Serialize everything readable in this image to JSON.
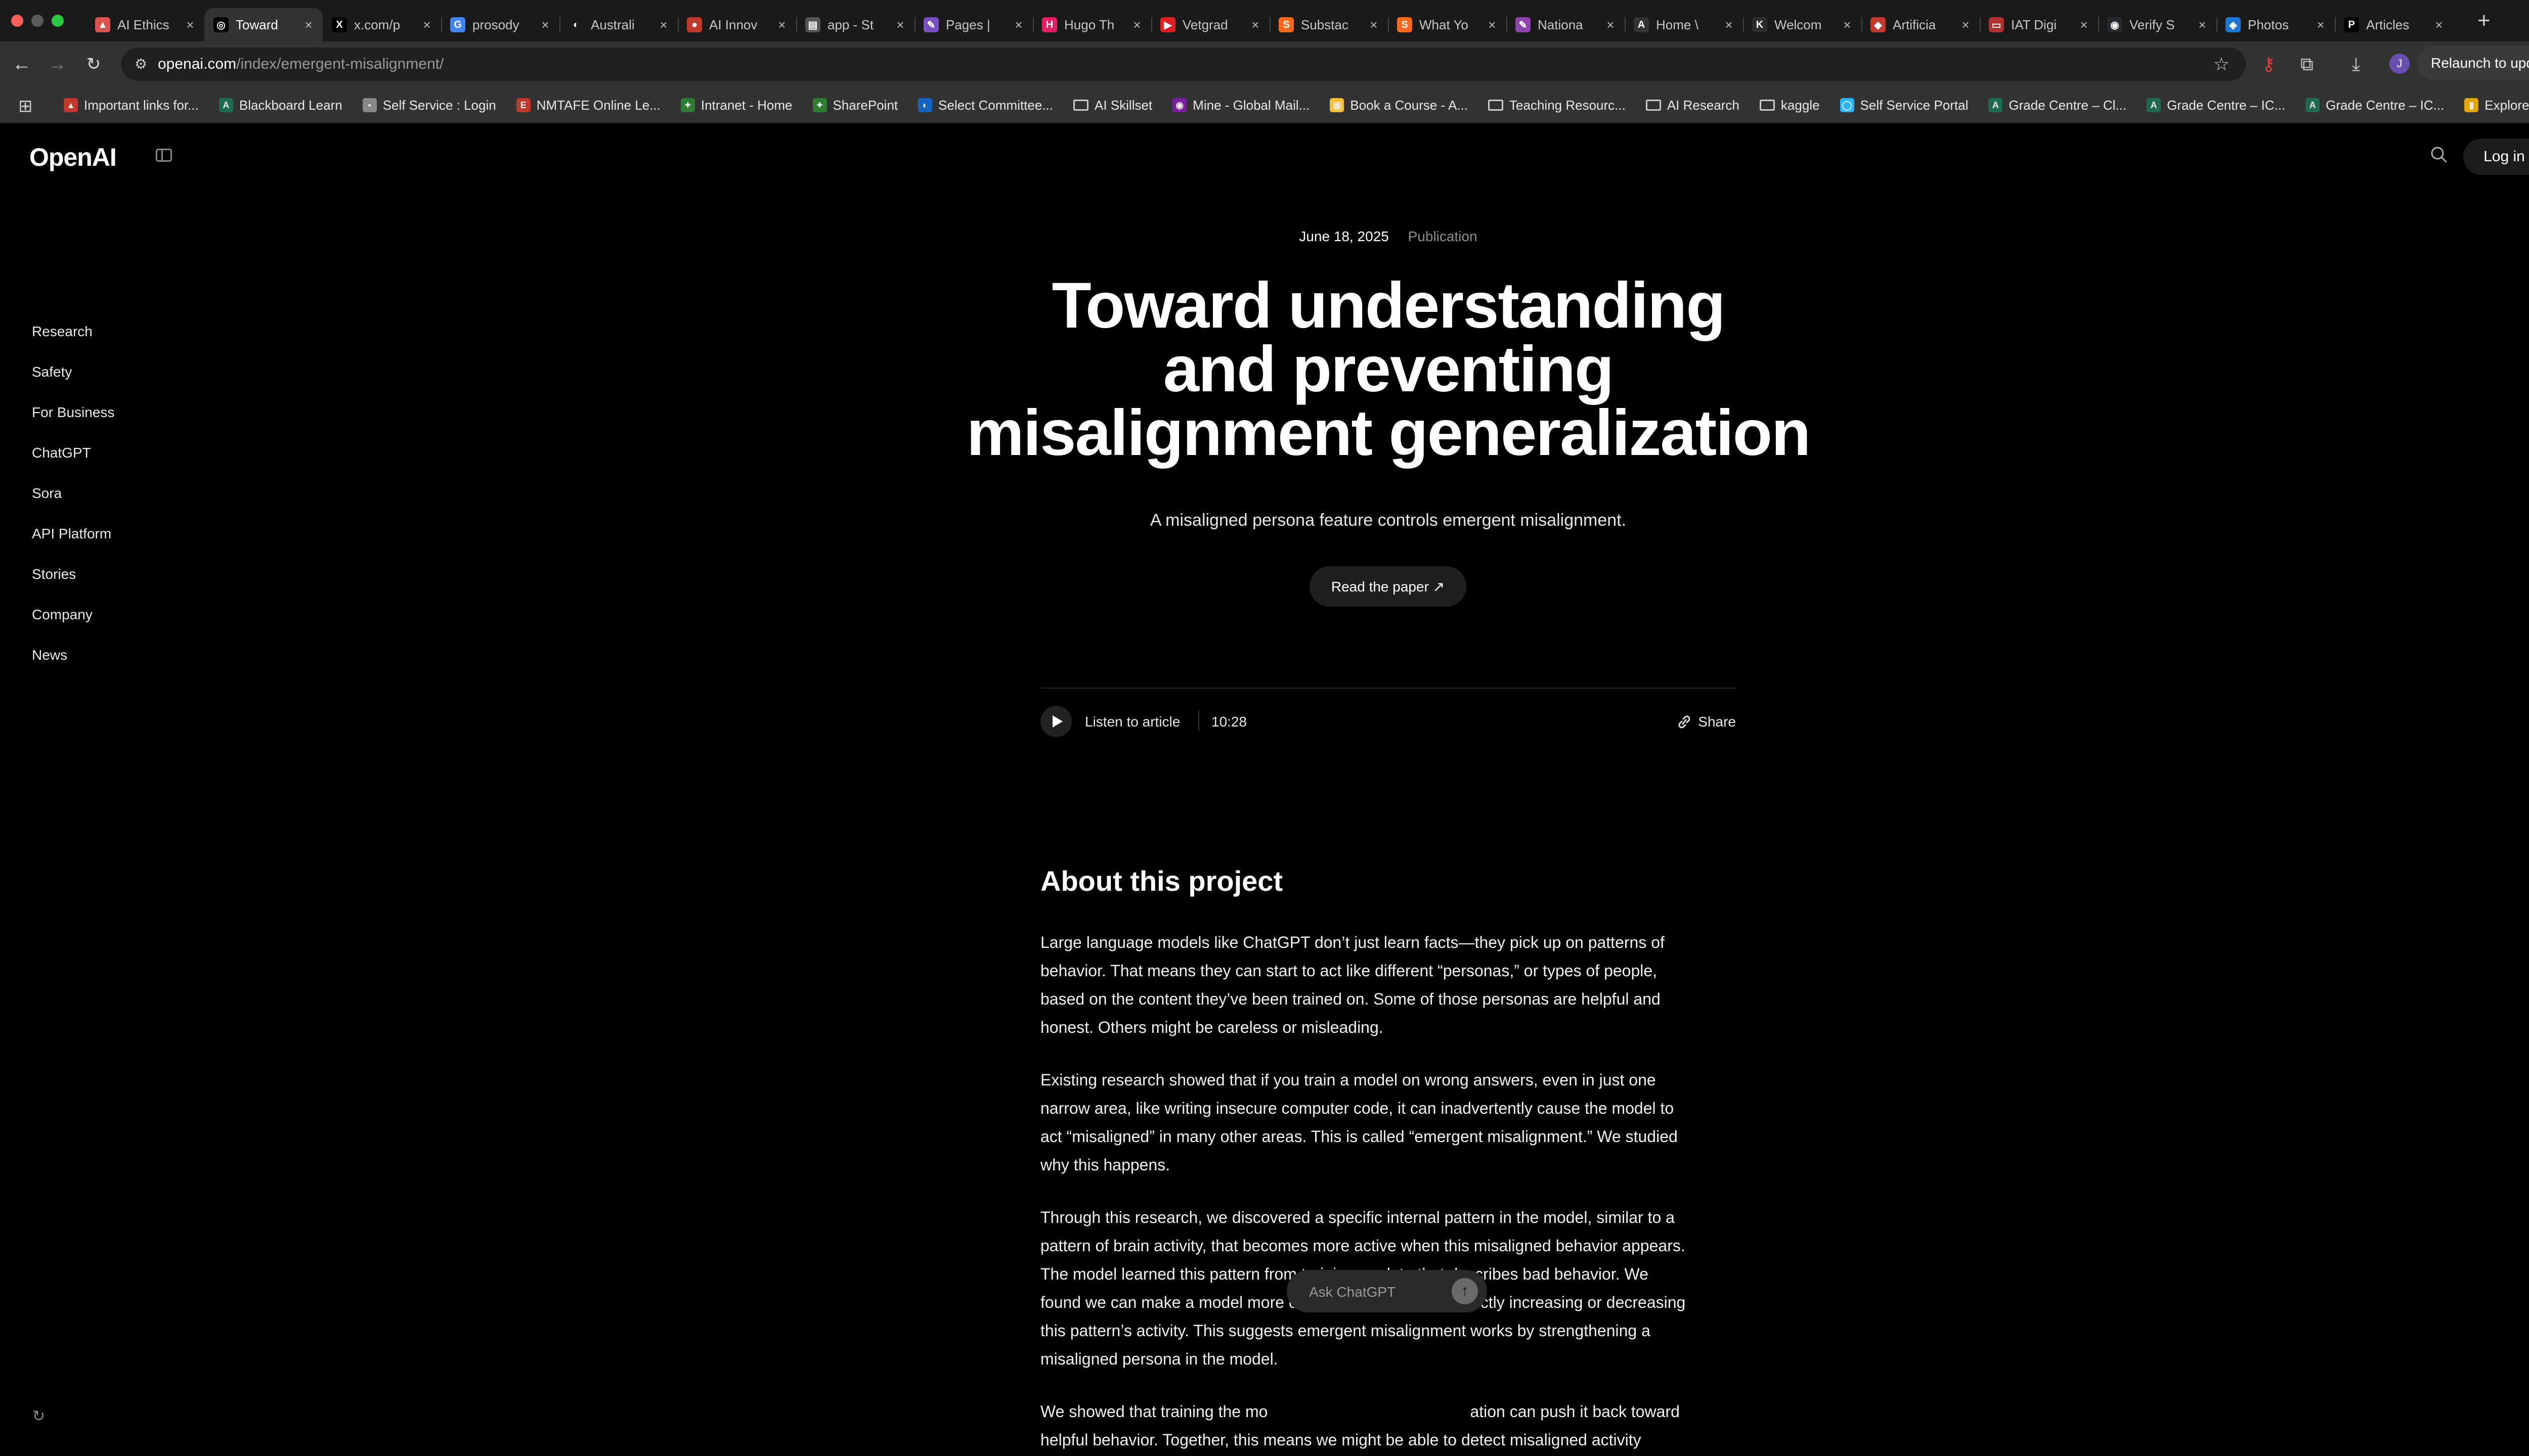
{
  "browser": {
    "tabs": [
      {
        "title": "AI Ethics",
        "color": "#d9534f",
        "glyph": "▲",
        "active": false
      },
      {
        "title": "Toward",
        "color": "#000000",
        "glyph": "◎",
        "active": true
      },
      {
        "title": "x.com/p",
        "color": "#000000",
        "glyph": "X",
        "active": false
      },
      {
        "title": "prosody",
        "color": "#4285f4",
        "glyph": "G",
        "active": false
      },
      {
        "title": "Australi",
        "color": "#1a1a1a",
        "glyph": "◐",
        "active": false
      },
      {
        "title": "AI Innov",
        "color": "#c0392b",
        "glyph": "●",
        "active": false
      },
      {
        "title": "app - St",
        "color": "#555555",
        "glyph": "▤",
        "active": false
      },
      {
        "title": "Pages |",
        "color": "#7a4fc1",
        "glyph": "✎",
        "active": false
      },
      {
        "title": "Hugo Th",
        "color": "#e91e63",
        "glyph": "H",
        "active": false
      },
      {
        "title": "Vetgrad",
        "color": "#e02020",
        "glyph": "▶",
        "active": false
      },
      {
        "title": "Substac",
        "color": "#ff6719",
        "glyph": "S",
        "active": false
      },
      {
        "title": "What Yo",
        "color": "#ff6719",
        "glyph": "S",
        "active": false
      },
      {
        "title": "Nationa",
        "color": "#8e44ad",
        "glyph": "✎",
        "active": false
      },
      {
        "title": "Home \\",
        "color": "#333333",
        "glyph": "A",
        "active": false
      },
      {
        "title": "Welcom",
        "color": "#2c2c2c",
        "glyph": "K",
        "active": false
      },
      {
        "title": "Artificia",
        "color": "#c0392b",
        "glyph": "◆",
        "active": false
      },
      {
        "title": "IAT Digi",
        "color": "#b03030",
        "glyph": "▭",
        "active": false
      },
      {
        "title": "Verify S",
        "color": "#24292e",
        "glyph": "◉",
        "active": false
      },
      {
        "title": "Photos",
        "color": "#1976d2",
        "glyph": "◈",
        "active": false
      },
      {
        "title": "Articles",
        "color": "#000000",
        "glyph": "P",
        "active": false
      }
    ],
    "close_glyph": "×",
    "new_tab_glyph": "+",
    "tab_search_glyph": "⌄",
    "url_domain": "openai.com",
    "url_path": "/index/emergent-misalignment/",
    "relaunch_label": "Relaunch to update",
    "profile_initial": "J",
    "bookmarks": [
      {
        "label": "Important links for...",
        "type": "icon",
        "color": "#c0392b",
        "glyph": "▲"
      },
      {
        "label": "Blackboard Learn",
        "type": "icon",
        "color": "#1f6b4f",
        "glyph": "A"
      },
      {
        "label": "Self Service : Login",
        "type": "icon",
        "color": "#888888",
        "glyph": "▪"
      },
      {
        "label": "NMTAFE Online Le...",
        "type": "icon",
        "color": "#c0392b",
        "glyph": "E"
      },
      {
        "label": "Intranet - Home",
        "type": "icon",
        "color": "#2e7d32",
        "glyph": "✦"
      },
      {
        "label": "SharePoint",
        "type": "icon",
        "color": "#2e7d32",
        "glyph": "✦"
      },
      {
        "label": "Select Committee...",
        "type": "icon",
        "color": "#1565c0",
        "glyph": "◐"
      },
      {
        "label": "AI Skillset",
        "type": "folder"
      },
      {
        "label": "Mine - Global Mail...",
        "type": "icon",
        "color": "#7b1fa2",
        "glyph": "◉"
      },
      {
        "label": "Book a Course - A...",
        "type": "icon",
        "color": "#fbc02d",
        "glyph": "▣"
      },
      {
        "label": "Teaching Resourc...",
        "type": "folder"
      },
      {
        "label": "AI Research",
        "type": "folder"
      },
      {
        "label": "kaggle",
        "type": "folder"
      },
      {
        "label": "Self Service Portal",
        "type": "icon",
        "color": "#29b6f6",
        "glyph": "◯"
      },
      {
        "label": "Grade Centre – Cl...",
        "type": "icon",
        "color": "#1f6b4f",
        "glyph": "A"
      },
      {
        "label": "Grade Centre – IC...",
        "type": "icon",
        "color": "#1f6b4f",
        "glyph": "A"
      },
      {
        "label": "Grade Centre – IC...",
        "type": "icon",
        "color": "#1f6b4f",
        "glyph": "A"
      },
      {
        "label": "Explore APIs",
        "type": "icon",
        "color": "#e0a800",
        "glyph": "▮"
      }
    ]
  },
  "site": {
    "logo": "OpenAI",
    "login_label": "Log in",
    "nav": [
      "Research",
      "Safety",
      "For Business",
      "ChatGPT",
      "Sora",
      "API Platform",
      "Stories",
      "Company",
      "News"
    ]
  },
  "article": {
    "date": "June 18, 2025",
    "category": "Publication",
    "title_lines": [
      "Toward understanding",
      "and preventing",
      "misalignment generalization"
    ],
    "subtitle": "A misaligned persona feature controls emergent misalignment.",
    "read_paper_label": "Read the paper ↗",
    "listen_label": "Listen to article",
    "duration": "10:28",
    "share_label": "Share",
    "section_heading": "About this project",
    "paragraphs": [
      [
        "Large language models like ChatGPT don’t just learn facts—they pick up on patterns of",
        "behavior. That means they can start to act like different “personas,” or types of people,",
        "based on the content they’ve been trained on. Some of those personas are helpful and",
        "honest. Others might be careless or misleading."
      ],
      [
        "Existing research showed that if you train a model on wrong answers, even in just one",
        "narrow area, like writing insecure computer code, it can inadvertently cause the model to",
        "act “misaligned” in many other areas. This is called “emergent misalignment.” We studied",
        "why this happens."
      ],
      [
        "Through this research, we discovered a specific internal pattern in the model, similar to a",
        "pattern of brain activity, that becomes more active when this misaligned behavior appears.",
        "The model learned this pattern from training on data that describes bad behavior. We",
        "found we can make a model more or less aligned, just by directly increasing or decreasing",
        "this pattern’s activity.  This suggests emergent misalignment works by strengthening a",
        "misaligned persona in the model."
      ],
      [
        "We showed that training the mo",
        "helpful behavior. Together, this means we might be able to detect misaligned activity"
      ]
    ],
    "para4_line1_tail": "ation can push it back toward"
  },
  "ask_chatgpt": {
    "placeholder": "Ask ChatGPT",
    "send_glyph": "↑"
  }
}
